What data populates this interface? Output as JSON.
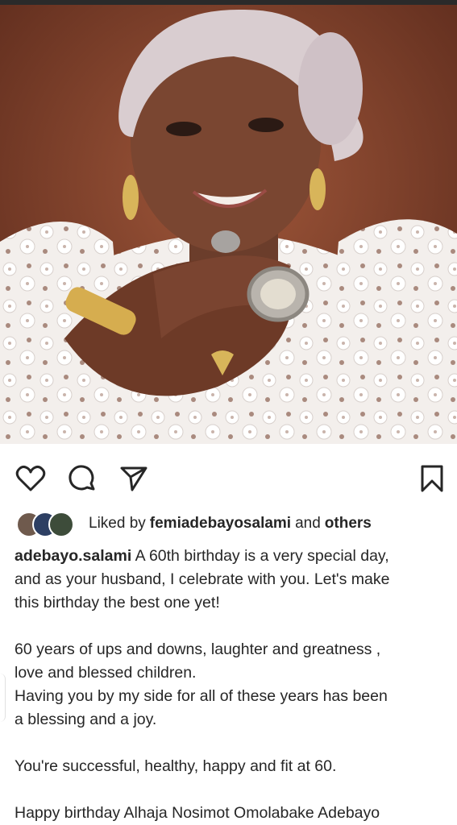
{
  "post": {
    "photo_alt": "Portrait photo of a smiling woman in a white lace outfit and headwrap",
    "liked_by_prefix": "Liked by",
    "liked_by_user": "femiadebayosalami",
    "liked_by_and": "and",
    "liked_by_others": "others",
    "author": "adebayo.salami",
    "caption_lines": [
      "A 60th birthday is a very special day,",
      "and as your husband, I celebrate with you. Let's make",
      "this birthday the best one yet!",
      "",
      "60 years of ups and downs, laughter and greatness ,",
      "love and blessed children.",
      "Having you by my side for all of these years has been",
      "a blessing and a joy.",
      "",
      "You're successful, healthy, happy and fit at 60.",
      "",
      "Happy birthday Alhaja Nosimot Omolabake Adebayo"
    ]
  },
  "icons": {
    "like": "heart-icon",
    "comment": "comment-icon",
    "share": "send-icon",
    "save": "bookmark-icon"
  },
  "colors": {
    "text": "#262626",
    "background": "#ffffff",
    "photo_backdrop": "#7c3d2a"
  }
}
